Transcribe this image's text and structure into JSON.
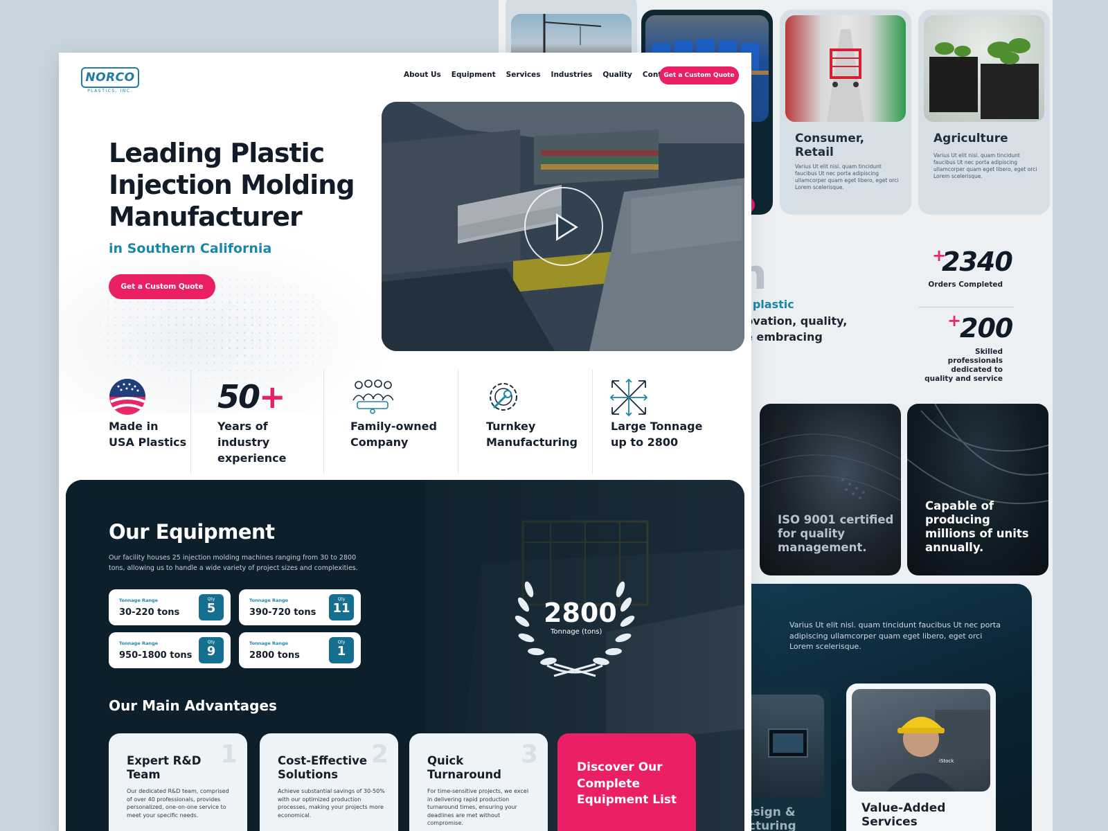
{
  "brand": {
    "logo_text": "NORCO",
    "logo_sub": "PLASTICS, INC."
  },
  "nav": {
    "items": [
      "About Us",
      "Equipment",
      "Services",
      "Industries",
      "Quality",
      "Contact"
    ],
    "cta": "Get a Custom Quote"
  },
  "hero": {
    "title": "Leading Plastic Injection Molding Manufacturer",
    "subtitle": "in Southern California",
    "cta": "Get a Custom Quote"
  },
  "highlights": [
    {
      "label_1": "Made in",
      "label_2": "USA Plastics",
      "icon": "usa-flag-icon"
    },
    {
      "big": "50+",
      "label_1": "Years of industry",
      "label_2": "experience"
    },
    {
      "label_1": "Family-owned",
      "label_2": "Company",
      "icon": "family-icon"
    },
    {
      "label_1": "Turnkey",
      "label_2": "Manufacturing",
      "icon": "gear-wrench-icon"
    },
    {
      "label_1": "Large Tonnage",
      "label_2": "up to 2800",
      "icon": "expand-arrows-icon"
    }
  ],
  "equipment": {
    "title": "Our Equipment",
    "description": "Our facility houses 25 injection molding machines ranging from 30 to 2800 tons, allowing us to handle a wide variety of project sizes and complexities.",
    "range_label": "Tonnage Range",
    "qty_label": "Qty",
    "ranges": [
      {
        "range": "30-220 tons",
        "qty": "5"
      },
      {
        "range": "390-720 tons",
        "qty": "11"
      },
      {
        "range": "950-1800 tons",
        "qty": "9"
      },
      {
        "range": "2800 tons",
        "qty": "1"
      }
    ],
    "badge_value": "2800",
    "badge_label": "Tonnage (tons)"
  },
  "advantages": {
    "title": "Our Main Advantages",
    "cards": [
      {
        "n": "1",
        "title": "Expert R&D Team",
        "desc": "Our dedicated R&D team, comprised of over 40 professionals, provides personalized, one-on-one service to meet your specific needs."
      },
      {
        "n": "2",
        "title": "Cost-Effective Solutions",
        "desc": "Achieve substantial savings of 30-50% with our optimized production processes, making your projects more economical."
      },
      {
        "n": "3",
        "title": "Quick Turnaround",
        "desc": "For time-sensitive projects, we excel in delivering rapid production turnaround times, ensuring your deadlines are met without compromise."
      }
    ],
    "cta": "Discover Our Complete Equipment List"
  },
  "back": {
    "industries": [
      {
        "title": "Consumer, Retail",
        "desc": "Varius Ut elit nisl. quam tincidunt faucibus Ut nec porta adipiscing ullamcorper quam eget libero, eget orci Lorem scelerisque."
      },
      {
        "title": "Agriculture",
        "desc": "Varius Ut elit nisl. quam tincidunt faucibus Ut nec porta adipiscing ullamcorper quam eget libero, eget orci Lorem scelerisque."
      }
    ],
    "partial_heading": "n",
    "partial_sub": "al plastic",
    "partial_lines": [
      "novation, quality,",
      "ile embracing"
    ],
    "stats": [
      {
        "num": "2340",
        "label": "Orders Completed"
      },
      {
        "num": "200",
        "label": "Skilled professionals dedicated to quality and service"
      }
    ],
    "features": [
      "ISO 9001 certified for quality management.",
      "Capable of producing millions of units annually."
    ],
    "services_text": "Varius Ut elit nisl. quam tincidunt faucibus Ut nec porta adipiscing ullamcorper quam eget libero, eget orci Lorem scelerisque.",
    "services": [
      "Design & facturing",
      "Value-Added Services"
    ],
    "photo_credit": "iStock"
  },
  "colors": {
    "accent": "#ea1f66",
    "teal": "#1a86a8",
    "dark": "#0d1f2b"
  }
}
